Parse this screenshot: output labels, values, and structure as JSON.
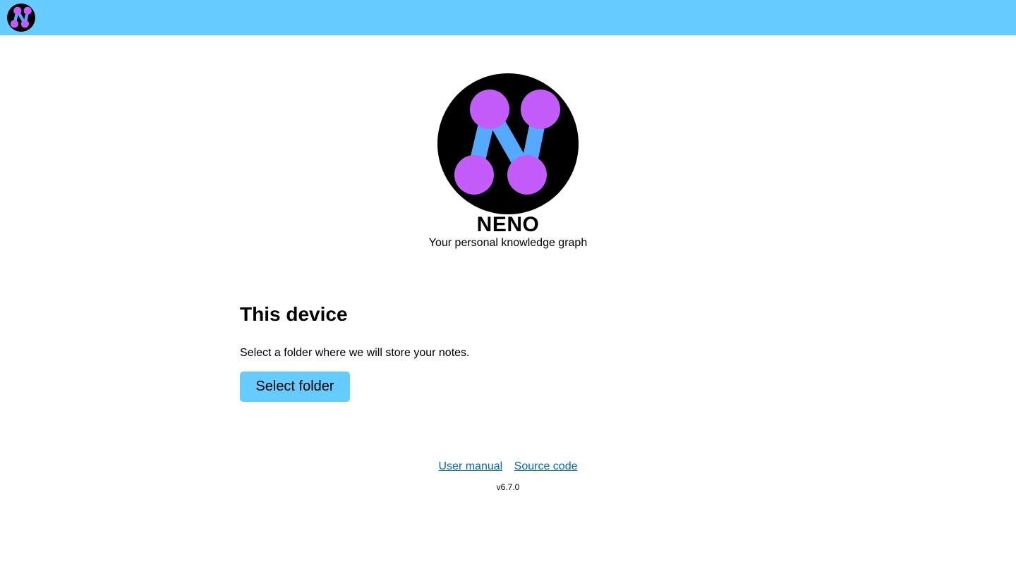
{
  "header": {
    "logo_icon": "neno-logo-icon",
    "background_color": "#66ccff"
  },
  "hero": {
    "logo_icon": "neno-logo-icon",
    "app_name": "NENO",
    "tagline": "Your personal knowledge graph"
  },
  "storage": {
    "heading": "This device",
    "description": "Select a folder where we will store your notes.",
    "button_label": "Select folder",
    "button_color": "#66ccff"
  },
  "footer": {
    "links": [
      {
        "label": "User manual"
      },
      {
        "label": "Source code"
      }
    ],
    "version": "v6.7.0",
    "link_color": "#0066cc"
  },
  "logo_colors": {
    "background": "#000000",
    "nodes": "#c45cfa",
    "edges": "#55aaff"
  }
}
